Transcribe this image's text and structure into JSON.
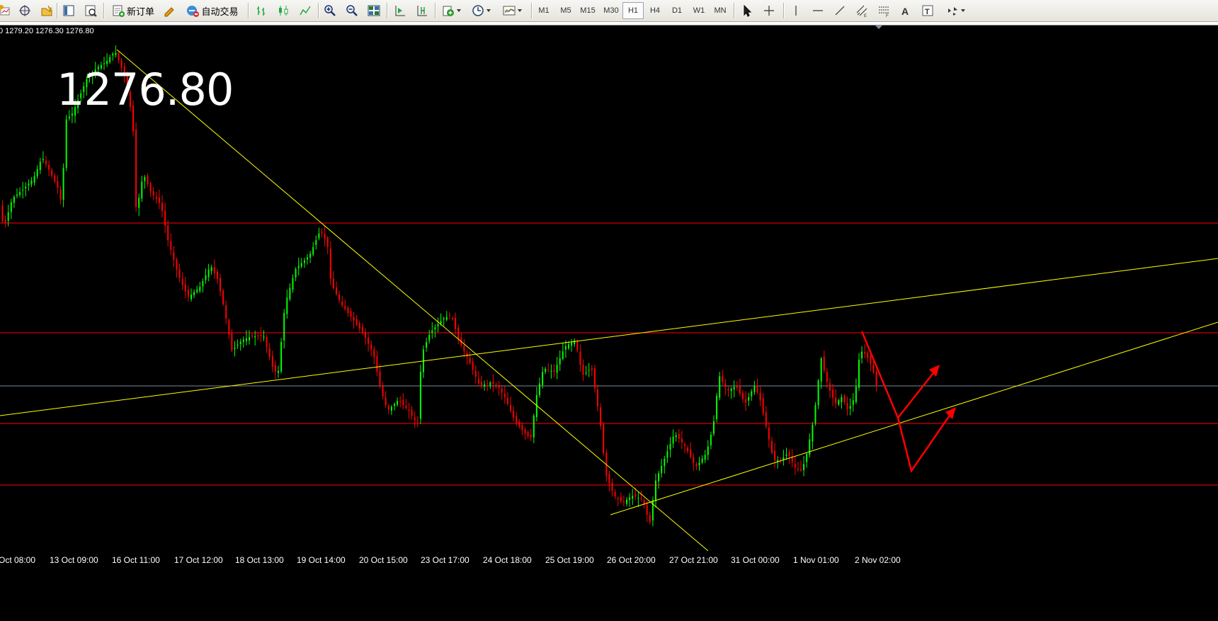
{
  "toolbar": {
    "new_order_label": "新订单",
    "auto_trade_label": "自动交易",
    "timeframes": [
      "M1",
      "M5",
      "M15",
      "M30",
      "H1",
      "H4",
      "D1",
      "W1",
      "MN"
    ],
    "active_timeframe": "H1",
    "icons": [
      "new-chart-icon",
      "move-icon",
      "profiles-icon",
      "navigator-icon",
      "data-window-icon",
      "new-order-icon",
      "metaeditor-icon",
      "auto-trading-icon",
      "bar-chart-icon",
      "candlestick-icon",
      "line-chart-icon",
      "zoom-in-icon",
      "zoom-out-icon",
      "tile-windows-icon",
      "autoscroll-icon",
      "chart-shift-icon",
      "indicators-icon",
      "periods-icon",
      "templates-icon",
      "cursor-icon",
      "crosshair-icon",
      "vertical-line-icon",
      "horizontal-line-icon",
      "trendline-icon",
      "equidistant-channel-icon",
      "fibonacci-icon",
      "text-icon",
      "text-label-icon",
      "arrows-icon"
    ]
  },
  "chart": {
    "ohlc_text": "0 1279.20 1276.30 1276.80",
    "current_price": "1276.80",
    "time_labels": [
      "Oct 08:00",
      "13 Oct 09:00",
      "16 Oct 11:00",
      "17 Oct 12:00",
      "18 Oct 13:00",
      "19 Oct 14:00",
      "20 Oct 15:00",
      "23 Oct 17:00",
      "24 Oct 18:00",
      "25 Oct 19:00",
      "26 Oct 20:00",
      "27 Oct 21:00",
      "31 Oct 00:00",
      "1 Nov 01:00",
      "2 Nov 02:00"
    ],
    "colors": {
      "background": "#000000",
      "bull": "#00ff00",
      "bear": "#ff0000",
      "horizontal_lines": "#ff0000",
      "trendlines": "#ffff00",
      "arrows": "#ff0000",
      "bid_line": "#778899"
    }
  }
}
